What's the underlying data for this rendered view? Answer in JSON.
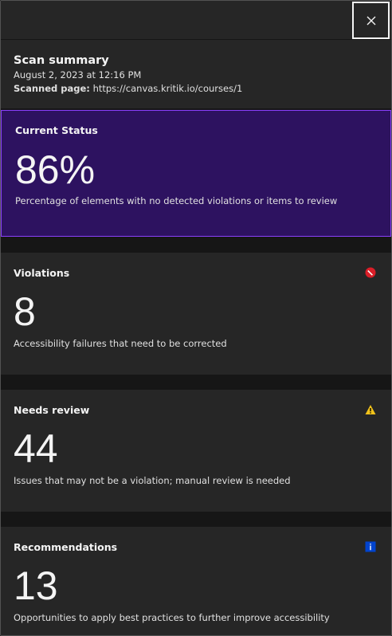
{
  "summary": {
    "title": "Scan summary",
    "date": "August 2, 2023 at 12:16 PM",
    "scanned_label": "Scanned page:",
    "scanned_url": "https://canvas.kritik.io/courses/1"
  },
  "status": {
    "label": "Current Status",
    "value": "86%",
    "description": "Percentage of elements with no detected violations or items to review"
  },
  "cards": [
    {
      "label": "Violations",
      "value": "8",
      "description": "Accessibility failures that need to be corrected",
      "icon": "violation-icon",
      "color": "#da1e28"
    },
    {
      "label": "Needs review",
      "value": "44",
      "description": "Issues that may not be a violation; manual review is needed",
      "icon": "warning-icon",
      "color": "#f1c21b"
    },
    {
      "label": "Recommendations",
      "value": "13",
      "description": "Opportunities to apply best practices to further improve accessibility",
      "icon": "info-icon",
      "color": "#0043ce"
    }
  ],
  "colors": {
    "status_bg": "#2d1260",
    "status_border": "#8a3ffc",
    "card_bg": "#262626",
    "page_bg": "#161616"
  }
}
